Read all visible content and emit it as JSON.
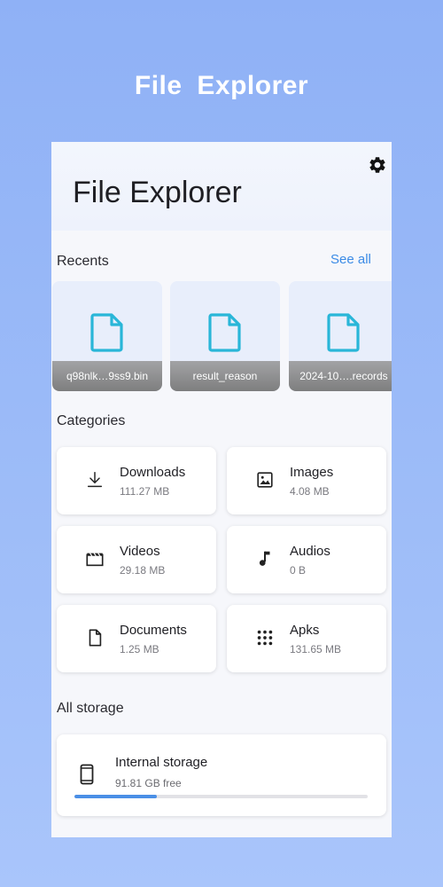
{
  "promo": {
    "title": "File  Explorer"
  },
  "header": {
    "title": "File Explorer"
  },
  "recents": {
    "label": "Recents",
    "see_all": "See all",
    "items": [
      {
        "name": "q98nlk…9ss9.bin"
      },
      {
        "name": "result_reason"
      },
      {
        "name": "2024-10….records"
      }
    ]
  },
  "categories": {
    "label": "Categories",
    "items": [
      {
        "name": "Downloads",
        "size": "111.27 MB",
        "icon": "download-icon"
      },
      {
        "name": "Images",
        "size": "4.08 MB",
        "icon": "image-icon"
      },
      {
        "name": "Videos",
        "size": "29.18 MB",
        "icon": "video-icon"
      },
      {
        "name": "Audios",
        "size": "0 B",
        "icon": "music-note-icon"
      },
      {
        "name": "Documents",
        "size": "1.25 MB",
        "icon": "document-icon"
      },
      {
        "name": "Apks",
        "size": "131.65 MB",
        "icon": "apps-grid-icon"
      }
    ]
  },
  "storage": {
    "label": "All storage",
    "items": [
      {
        "name": "Internal storage",
        "free": "91.81 GB free",
        "used_fraction": 0.28,
        "icon": "phone-icon"
      }
    ]
  },
  "colors": {
    "accent": "#3b8be6",
    "file_icon": "#29b6d8",
    "progress": "#4a8fe6",
    "background_top": "#8fb1f6",
    "background_bottom": "#a9c5fb"
  }
}
